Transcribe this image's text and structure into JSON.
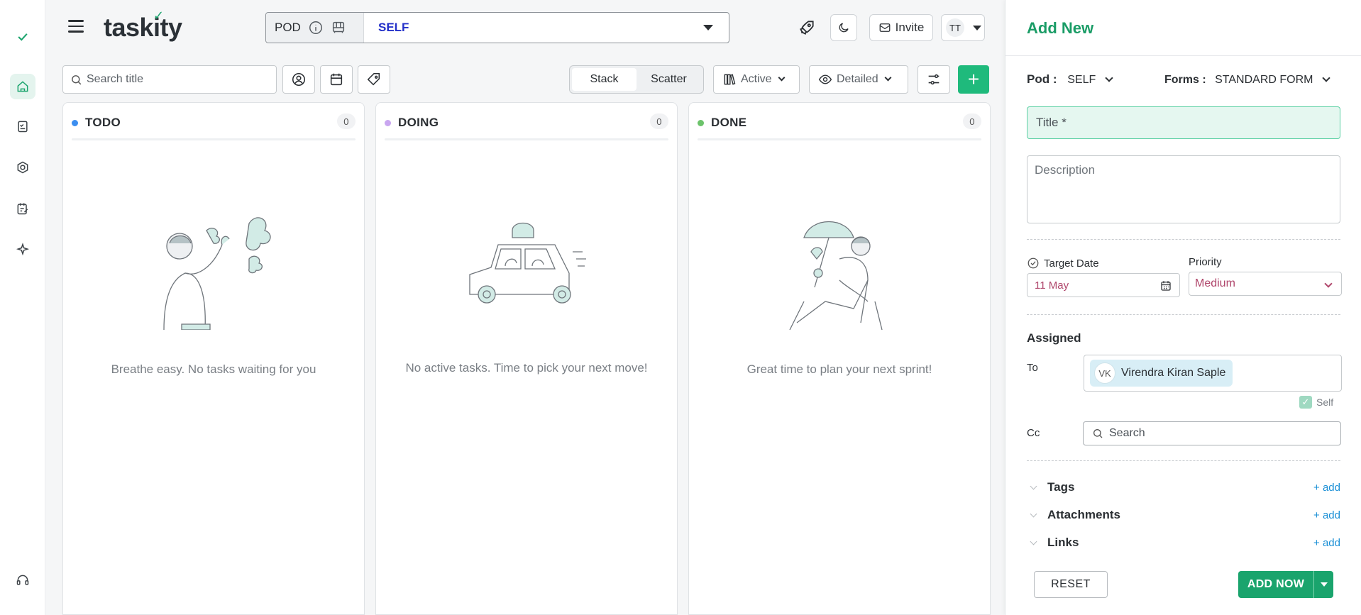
{
  "app": {
    "name": "taskity"
  },
  "topbar": {
    "pod_label": "POD",
    "pod_value": "SELF",
    "invite_label": "Invite",
    "user_initials": "TT"
  },
  "toolbar": {
    "search_placeholder": "Search title",
    "view_modes": [
      "Stack",
      "Scatter"
    ],
    "active_view": "Stack",
    "status_filter": "Active",
    "detail_filter": "Detailed"
  },
  "columns": [
    {
      "title": "TODO",
      "count": "0",
      "color": "#3b8ef0",
      "empty_text": "Breathe easy. No tasks waiting for you"
    },
    {
      "title": "DOING",
      "count": "0",
      "color": "#c9a6f0",
      "empty_text": "No active tasks. Time to pick your next move!"
    },
    {
      "title": "DONE",
      "count": "0",
      "color": "#6cc36b",
      "empty_text": "Great time to plan your next sprint!"
    }
  ],
  "panel": {
    "title": "Add New",
    "pod_label": "Pod :",
    "pod_value": "SELF",
    "forms_label": "Forms :",
    "forms_value": "STANDARD FORM",
    "title_placeholder": "Title *",
    "description_placeholder": "Description",
    "target_date_label": "Target Date",
    "target_date_value": "11 May",
    "priority_label": "Priority",
    "priority_value": "Medium",
    "assigned_label": "Assigned",
    "to_label": "To",
    "assignee_initials": "VK",
    "assignee_name": "Virendra Kiran Saple",
    "self_label": "Self",
    "cc_label": "Cc",
    "cc_placeholder": "Search",
    "sections": [
      {
        "label": "Tags",
        "action": "+ add"
      },
      {
        "label": "Attachments",
        "action": "+ add"
      },
      {
        "label": "Links",
        "action": "+ add"
      }
    ],
    "reset_label": "RESET",
    "submit_label": "ADD NOW"
  },
  "colors": {
    "brand": "#1aa46d",
    "accent_blue": "#2330c9",
    "priority": "#b0476c"
  }
}
